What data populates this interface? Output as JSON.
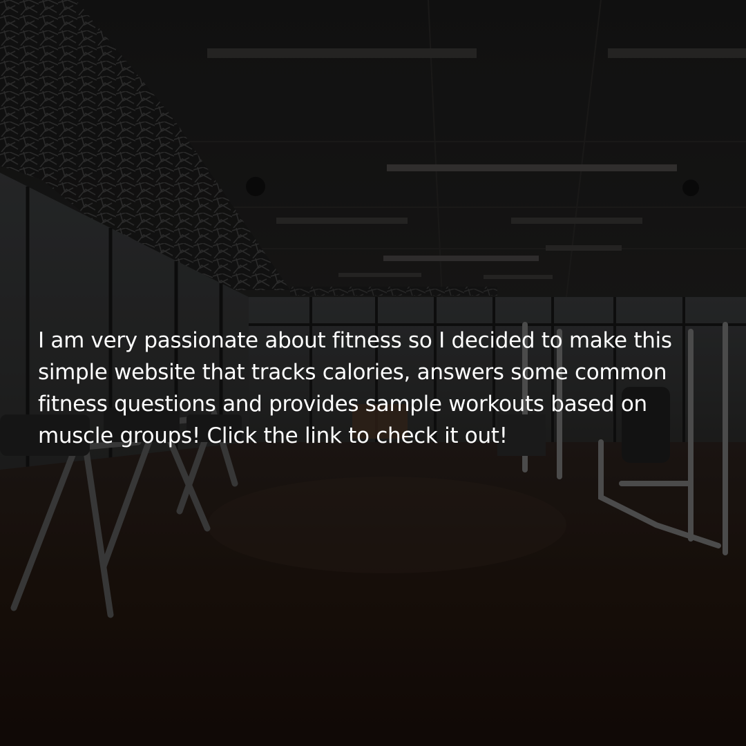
{
  "post": {
    "caption": "I am very passionate about fitness so I decided to make this simple website that tracks calories, answers some common fitness questions and provides sample workouts based on muscle groups! Click the link to check it out!"
  },
  "background": {
    "icon": "gym-interior-photo",
    "tint_color": "#000000",
    "floor_color": "#2a1c14",
    "ceiling_color": "#1e1e1e"
  }
}
